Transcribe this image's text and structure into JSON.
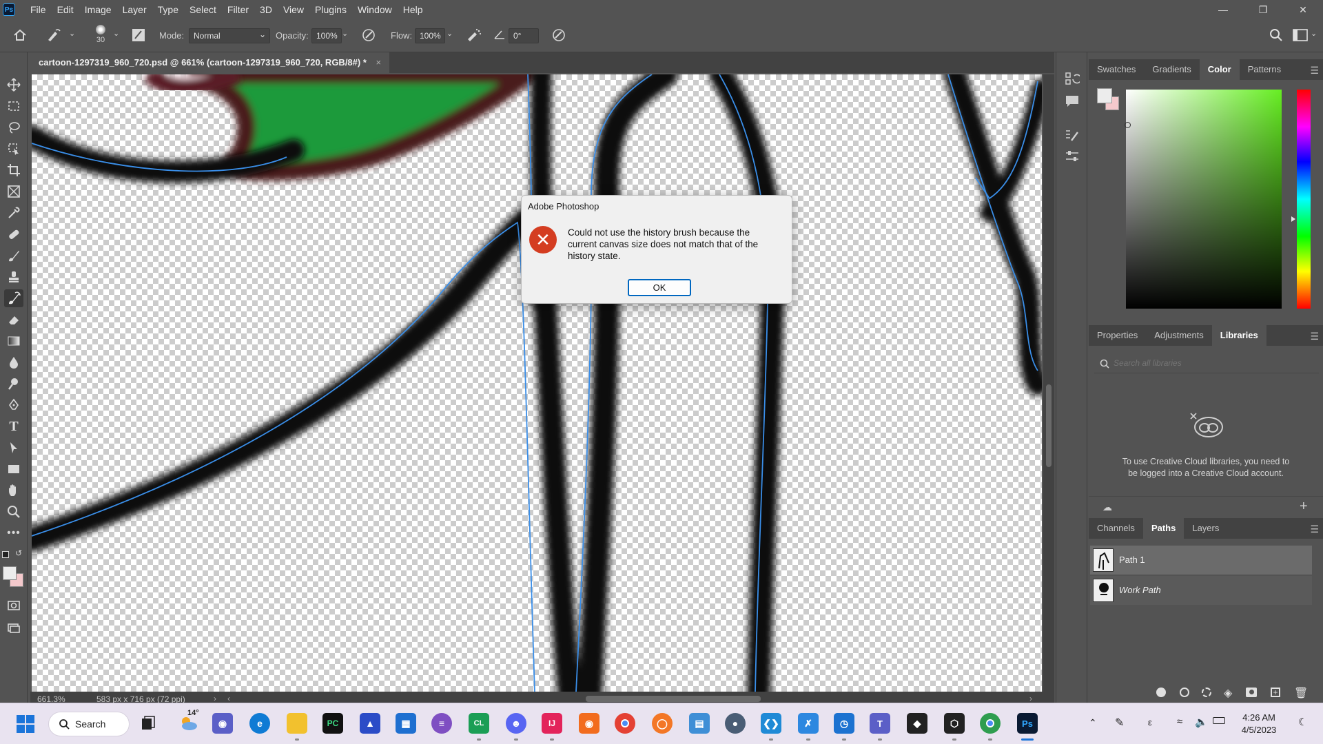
{
  "app": {
    "logo_text": "Ps",
    "menu": [
      "File",
      "Edit",
      "Image",
      "Layer",
      "Type",
      "Select",
      "Filter",
      "3D",
      "View",
      "Plugins",
      "Window",
      "Help"
    ],
    "window_controls": [
      "minimize-icon",
      "restore-icon",
      "close-icon"
    ]
  },
  "options_bar": {
    "brush_size": "30",
    "mode_label": "Mode:",
    "mode_value": "Normal",
    "opacity_label": "Opacity:",
    "opacity_value": "100%",
    "flow_label": "Flow:",
    "flow_value": "100%",
    "angle_value": "0°"
  },
  "document": {
    "tab_title": "cartoon-1297319_960_720.psd @ 661% (cartoon-1297319_960_720, RGB/8#) *",
    "tab_close": "×",
    "zoom": "661.3%",
    "doc_info": "583 px x 716 px (72 ppi)"
  },
  "dialog": {
    "title": "Adobe Photoshop",
    "icon": "error-icon",
    "message": "Could not use the history brush because the current canvas size does not match that of the history state.",
    "ok_label": "OK"
  },
  "panels": {
    "color_tabs": [
      "Swatches",
      "Gradients",
      "Color",
      "Patterns"
    ],
    "color_active": "Color",
    "props_tabs": [
      "Properties",
      "Adjustments",
      "Libraries"
    ],
    "props_active": "Libraries",
    "libraries": {
      "search_placeholder": "Search all libraries",
      "message": "To use Creative Cloud libraries, you need to be logged into a Creative Cloud account."
    },
    "layers_tabs": [
      "Channels",
      "Paths",
      "Layers"
    ],
    "layers_active": "Paths",
    "paths": [
      {
        "name": "Path 1",
        "selected": true,
        "italic": false
      },
      {
        "name": "Work Path",
        "selected": false,
        "italic": true
      }
    ]
  },
  "taskbar": {
    "search_label": "Search",
    "weather": "14°",
    "time": "4:26 AM",
    "date": "4/5/2023"
  },
  "colors": {
    "ui_bg": "#535353",
    "panel_dark": "#424242",
    "dialog_accent": "#0067c0",
    "error_red": "#d43d21",
    "path_line": "#3a8ee8"
  }
}
